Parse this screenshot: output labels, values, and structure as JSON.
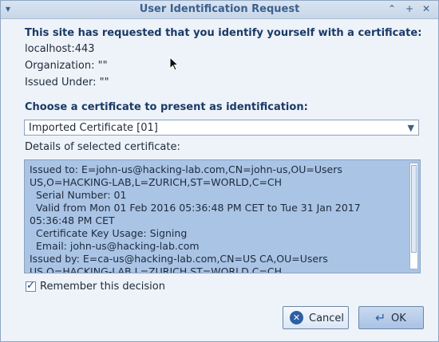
{
  "window": {
    "title": "User Identification Request",
    "controls": [
      "chevron-up-icon",
      "plus-icon",
      "close-icon"
    ]
  },
  "request": {
    "heading": "This site has requested that you identify yourself with a certificate:",
    "host": "localhost:443",
    "organization": "Organization: \"\"",
    "issued_under": "Issued Under: \"\""
  },
  "choose": {
    "heading": "Choose a certificate to present as identification:",
    "selected": "Imported Certificate [01]"
  },
  "details": {
    "label": "Details of selected certificate:",
    "lines": [
      "Issued to: E=john-us@hacking-lab.com,CN=john-us,OU=Users",
      "US,O=HACKING-LAB,L=ZURICH,ST=WORLD,C=CH",
      "Serial Number: 01",
      "Valid from Mon 01 Feb 2016 05:36:48 PM CET to Tue 31 Jan 2017",
      "05:36:48 PM CET",
      "Certificate Key Usage: Signing",
      "Email: john-us@hacking-lab.com",
      "Issued by: E=ca-us@hacking-lab.com,CN=US CA,OU=Users",
      "US,O=HACKING-LAB,L=ZURICH,ST=WORLD,C=CH"
    ]
  },
  "remember": {
    "label": "Remember this decision",
    "checked": true
  },
  "buttons": {
    "cancel": "Cancel",
    "ok": "OK"
  },
  "colors": {
    "accent": "#3d5f8e",
    "details_bg": "#aac4e6",
    "window_bg": "#eef3f9"
  }
}
